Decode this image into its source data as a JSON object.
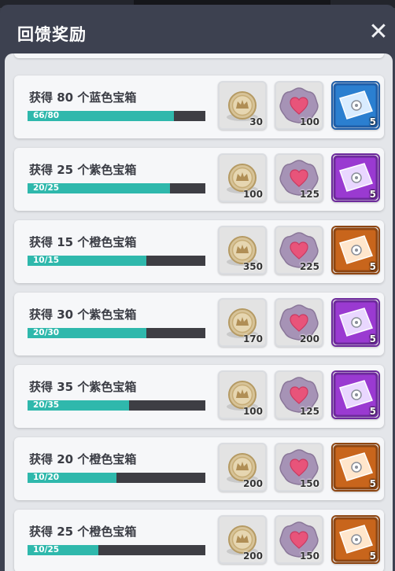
{
  "dialog": {
    "title": "回馈奖励",
    "close_glyph": "✕"
  },
  "colors": {
    "progress_fill": "#2fb8ac",
    "progress_track": "#3e3e44",
    "blue_chest": "#2b7fd0",
    "purple_chest": "#9a3ad1",
    "orange_chest": "#c8651c"
  },
  "rows": [
    {
      "title": "获得 80 个蓝色宝箱",
      "progress": "66/80",
      "fraction": 0.825,
      "chest_color": "blue",
      "rewards": {
        "coin": "30",
        "heart": "100",
        "chest": "5"
      }
    },
    {
      "title": "获得 25 个紫色宝箱",
      "progress": "20/25",
      "fraction": 0.8,
      "chest_color": "purple",
      "rewards": {
        "coin": "100",
        "heart": "125",
        "chest": "5"
      }
    },
    {
      "title": "获得 15 个橙色宝箱",
      "progress": "10/15",
      "fraction": 0.667,
      "chest_color": "orange",
      "rewards": {
        "coin": "350",
        "heart": "225",
        "chest": "5"
      }
    },
    {
      "title": "获得 30 个紫色宝箱",
      "progress": "20/30",
      "fraction": 0.667,
      "chest_color": "purple",
      "rewards": {
        "coin": "170",
        "heart": "200",
        "chest": "5"
      }
    },
    {
      "title": "获得 35 个紫色宝箱",
      "progress": "20/35",
      "fraction": 0.571,
      "chest_color": "purple",
      "rewards": {
        "coin": "100",
        "heart": "125",
        "chest": "5"
      }
    },
    {
      "title": "获得 20 个橙色宝箱",
      "progress": "10/20",
      "fraction": 0.5,
      "chest_color": "orange",
      "rewards": {
        "coin": "200",
        "heart": "150",
        "chest": "5"
      }
    },
    {
      "title": "获得 25 个橙色宝箱",
      "progress": "10/25",
      "fraction": 0.4,
      "chest_color": "orange",
      "rewards": {
        "coin": "200",
        "heart": "150",
        "chest": "5"
      }
    }
  ]
}
